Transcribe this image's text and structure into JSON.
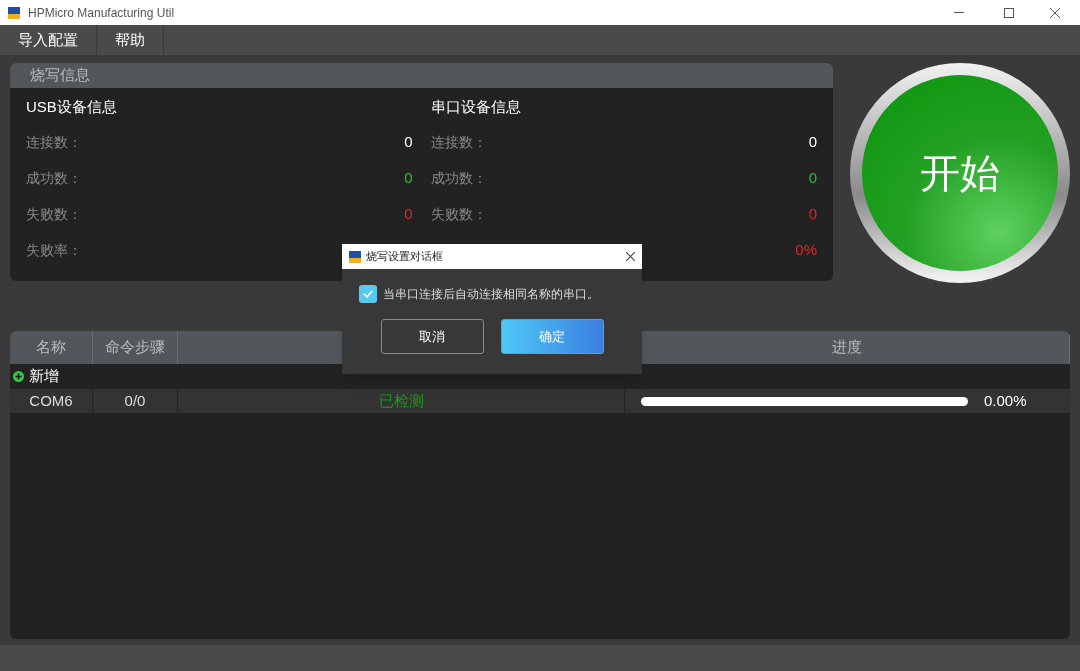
{
  "window": {
    "title": "HPMicro Manufacturing Util"
  },
  "menu": [
    "导入配置",
    "帮助"
  ],
  "info_panel": {
    "title": "烧写信息",
    "sections": [
      {
        "title": "USB设备信息",
        "rows": [
          {
            "label": "连接数：",
            "value": "0",
            "kind": "neutral"
          },
          {
            "label": "成功数：",
            "value": "0",
            "kind": "success"
          },
          {
            "label": "失败数：",
            "value": "0",
            "kind": "fail"
          },
          {
            "label": "失败率："
          }
        ]
      },
      {
        "title": "串口设备信息",
        "rows": [
          {
            "label": "连接数：",
            "value": "0",
            "kind": "neutral"
          },
          {
            "label": "成功数：",
            "value": "0",
            "kind": "success"
          },
          {
            "label": "失败数：",
            "value": "0",
            "kind": "fail"
          },
          {
            "value": "0%",
            "kind": "fail"
          }
        ]
      }
    ]
  },
  "start_button": {
    "label": "开始"
  },
  "table": {
    "columns": [
      "名称",
      "命令步骤",
      null,
      "进度"
    ],
    "add_row": {
      "label": "新增"
    },
    "rows": [
      {
        "name": "COM6",
        "steps": "0/0",
        "status": "已检测",
        "level": 0,
        "percent": "0.00%"
      }
    ]
  },
  "dialog": {
    "title": "烧写设置对话框",
    "checkbox": {
      "label": "当串口连接后自动连接相同名称的串口。",
      "checked": true
    },
    "buttons": [
      {
        "label": "取消",
        "kind": "secondary"
      },
      {
        "label": "确定",
        "kind": "primary"
      }
    ]
  }
}
